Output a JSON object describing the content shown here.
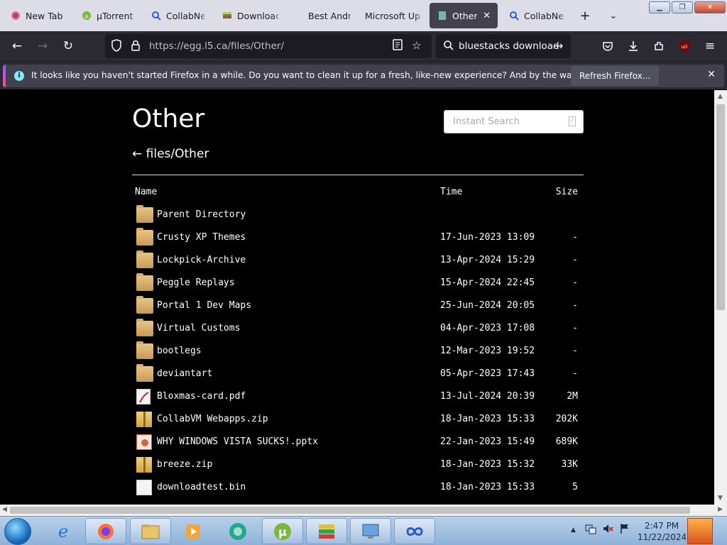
{
  "tabs": [
    {
      "label": "New Tab",
      "icon": "firefox-icon"
    },
    {
      "label": "µTorrent W",
      "icon": "utorrent-icon"
    },
    {
      "label": "CollabNet",
      "icon": "search-icon"
    },
    {
      "label": "Download",
      "icon": "bluestacks-icon"
    },
    {
      "label": "Best Andr",
      "icon": ""
    },
    {
      "label": "Microsoft Upd",
      "icon": ""
    },
    {
      "label": "Other –",
      "icon": "page-icon"
    },
    {
      "label": "CollabNet",
      "icon": "search-icon"
    }
  ],
  "navbar": {
    "url": "https://egg.l5.ca/files/Other/",
    "search_text": "bluestacks download"
  },
  "notification": {
    "message": "It looks like you haven't started Firefox in a while. Do you want to clean it up for a fresh, like-new experience? And by the way, welcome back!",
    "button_label": "Refresh Firefox..."
  },
  "page": {
    "title": "Other",
    "breadcrumb": "← files/Other",
    "search_placeholder": "Instant Search",
    "columns": {
      "name": "Name",
      "time": "Time",
      "size": "Size"
    },
    "rows": [
      {
        "name": "Parent Directory",
        "time": "",
        "size": "",
        "type": "folder"
      },
      {
        "name": "Crusty XP Themes",
        "time": "17-Jun-2023 13:09",
        "size": "-",
        "type": "folder"
      },
      {
        "name": "Lockpick-Archive",
        "time": "13-Apr-2024 15:29",
        "size": "-",
        "type": "folder"
      },
      {
        "name": "Peggle Replays",
        "time": "15-Apr-2024 22:45",
        "size": "-",
        "type": "folder"
      },
      {
        "name": "Portal 1 Dev Maps",
        "time": "25-Jun-2024 20:05",
        "size": "-",
        "type": "folder"
      },
      {
        "name": "Virtual Customs",
        "time": "04-Apr-2023 17:08",
        "size": "-",
        "type": "folder"
      },
      {
        "name": "bootlegs",
        "time": "12-Mar-2023 19:52",
        "size": "-",
        "type": "folder"
      },
      {
        "name": "deviantart",
        "time": "05-Apr-2023 17:43",
        "size": "-",
        "type": "folder"
      },
      {
        "name": "Bloxmas-card.pdf",
        "time": "13-Jul-2024 20:39",
        "size": "2M",
        "type": "pdf"
      },
      {
        "name": "CollabVM Webapps.zip",
        "time": "18-Jan-2023 15:33",
        "size": "202K",
        "type": "zip"
      },
      {
        "name": "WHY WINDOWS VISTA SUCKS!.pptx",
        "time": "22-Jan-2023 15:49",
        "size": "689K",
        "type": "pptx"
      },
      {
        "name": "breeze.zip",
        "time": "18-Jan-2023 15:32",
        "size": "33K",
        "type": "zip"
      },
      {
        "name": "downloadtest.bin",
        "time": "18-Jan-2023 15:33",
        "size": "5",
        "type": "bin"
      }
    ]
  },
  "taskbar": {
    "clock_time": "2:47 PM",
    "clock_date": "11/22/2024"
  }
}
